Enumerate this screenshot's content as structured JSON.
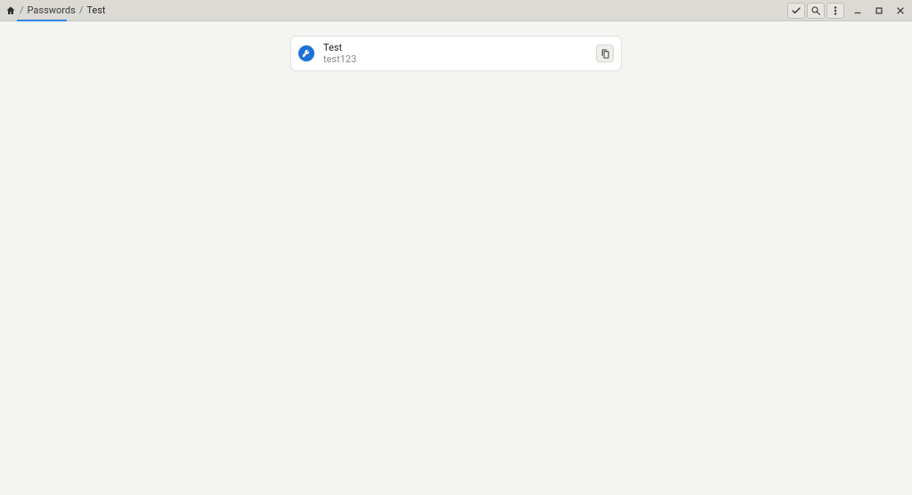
{
  "breadcrumb": {
    "section": "Passwords",
    "current": "Test"
  },
  "entry": {
    "title": "Test",
    "username": "test123"
  }
}
